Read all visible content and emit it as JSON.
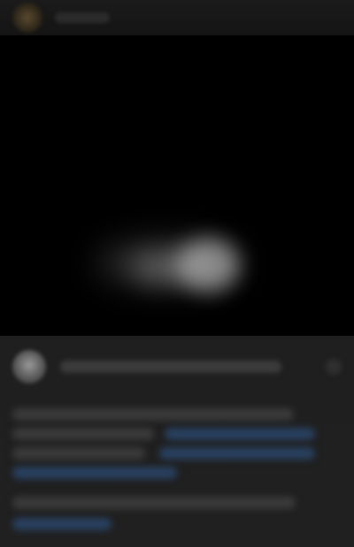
{
  "header": {
    "account_name": ""
  },
  "post": {
    "author_name": "",
    "caption": ""
  },
  "colors": {
    "background": "#000000",
    "panel": "#202020",
    "link": "#28405f"
  },
  "icons": {
    "header_avatar": "avatar",
    "post_avatar": "avatar",
    "more": "more-options-icon"
  }
}
